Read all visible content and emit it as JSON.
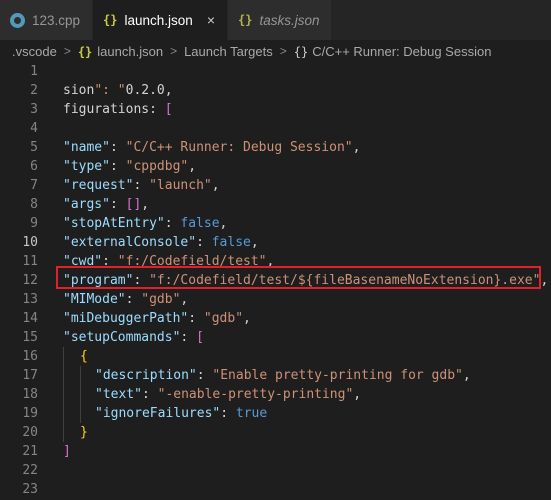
{
  "tabs": [
    {
      "label": "123.cpp",
      "icon": "cpp-file-icon",
      "active": false,
      "italic": false
    },
    {
      "label": "launch.json",
      "icon": "json-braces-icon",
      "active": true,
      "italic": false
    },
    {
      "label": "tasks.json",
      "icon": "json-braces-icon",
      "active": false,
      "italic": true
    }
  ],
  "tab_close_glyph": "×",
  "breadcrumb": {
    "items": [
      ".vscode",
      "launch.json",
      "Launch Targets",
      "C/C++ Runner: Debug Session"
    ],
    "separator": ">",
    "object_icon": "{}"
  },
  "editor": {
    "current_line": 10,
    "lines": [
      {
        "n": "1",
        "text": ""
      },
      {
        "n": "2",
        "text": "sion\": \"0.2.0\","
      },
      {
        "n": "3",
        "text": "figurations\": ["
      },
      {
        "n": "4",
        "text": ""
      },
      {
        "n": "5",
        "text": "\"name\": \"C/C++ Runner: Debug Session\","
      },
      {
        "n": "6",
        "text": "\"type\": \"cppdbg\","
      },
      {
        "n": "7",
        "text": "\"request\": \"launch\","
      },
      {
        "n": "8",
        "text": "\"args\": [],"
      },
      {
        "n": "9",
        "text": "\"stopAtEntry\": false,"
      },
      {
        "n": "10",
        "text": "\"externalConsole\": false,"
      },
      {
        "n": "11",
        "text": "\"cwd\": \"f:/Codefield/test\","
      },
      {
        "n": "12",
        "text": "\"program\": \"f:/Codefield/test/${fileBasenameNoExtension}.exe\","
      },
      {
        "n": "13",
        "text": "\"MIMode\": \"gdb\","
      },
      {
        "n": "14",
        "text": "\"miDebuggerPath\": \"gdb\","
      },
      {
        "n": "15",
        "text": "\"setupCommands\": ["
      },
      {
        "n": "16",
        "text": "{"
      },
      {
        "n": "17",
        "text": "\"description\": \"Enable pretty-printing for gdb\","
      },
      {
        "n": "18",
        "text": "\"text\": \"-enable-pretty-printing\","
      },
      {
        "n": "19",
        "text": "\"ignoreFailures\": true"
      },
      {
        "n": "20",
        "text": "}"
      },
      {
        "n": "21",
        "text": "]"
      },
      {
        "n": "22",
        "text": ""
      },
      {
        "n": "23",
        "text": ""
      }
    ]
  },
  "colors": {
    "background": "#1e1e1e",
    "key": "#9cdcfe",
    "string": "#ce9178",
    "keyword": "#569cd6",
    "highlight_box": "#e1202a"
  }
}
